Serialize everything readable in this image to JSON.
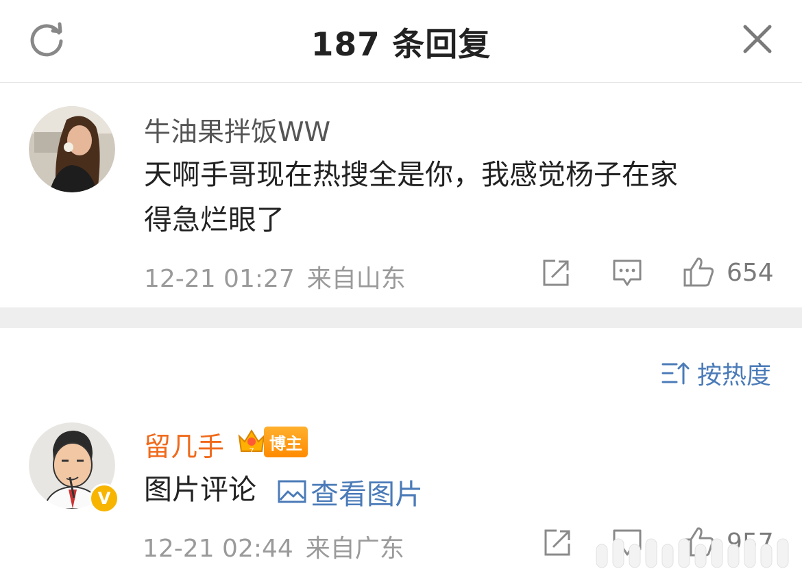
{
  "header": {
    "title": "187 条回复",
    "refresh_icon": "refresh-icon",
    "close_icon": "close-icon"
  },
  "root_comment": {
    "username": "牛油果拌饭WW",
    "text_line1": "天啊手哥现在热搜全是你，我感觉杨子在家",
    "text_line2": "得急烂眼了",
    "timestamp": "12-21 01:27",
    "location": "来自山东",
    "likes": "654",
    "username_color": "#555555"
  },
  "sort": {
    "label": "按热度",
    "icon": "sort-icon"
  },
  "reply": {
    "username": "留几手",
    "badge_label": "博主",
    "badge_level": "7",
    "verified_label": "V",
    "text": "图片评论",
    "link_label": "查看图片",
    "timestamp": "12-21 02:44",
    "location": "来自广东",
    "likes": "957",
    "username_color": "#f06a1c",
    "link_color": "#4b7bb8"
  }
}
